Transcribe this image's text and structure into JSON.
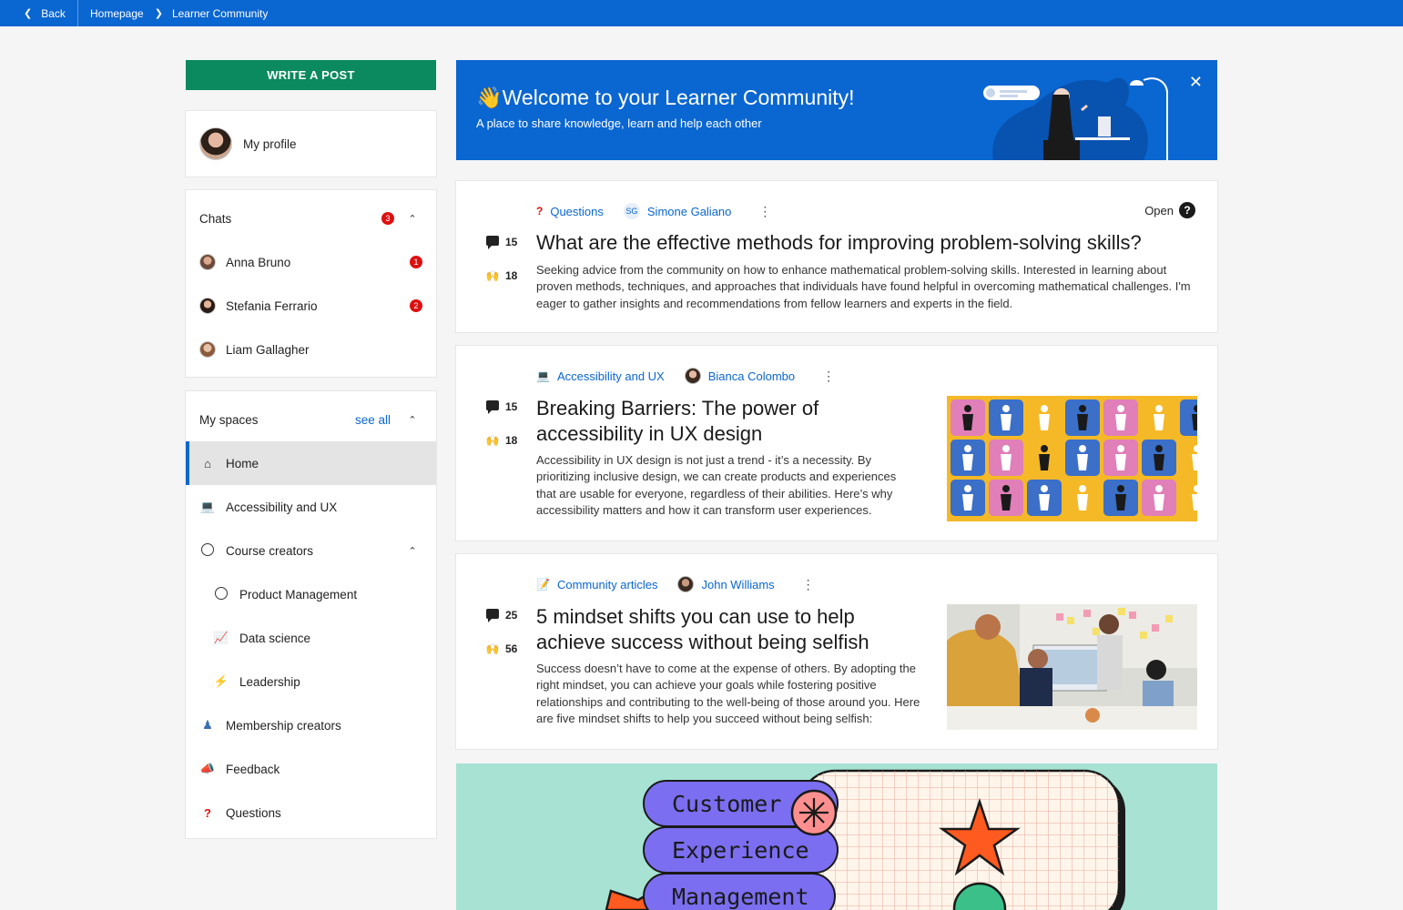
{
  "topbar": {
    "back": "Back",
    "crumbs": [
      "Homepage",
      "Learner Community"
    ]
  },
  "left": {
    "write_post": "WRITE A POST",
    "profile": "My profile",
    "chats": {
      "title": "Chats",
      "count": "3",
      "items": [
        {
          "name": "Anna Bruno",
          "unread": "1"
        },
        {
          "name": "Stefania Ferrario",
          "unread": "2"
        },
        {
          "name": "Liam Gallagher",
          "unread": ""
        }
      ]
    },
    "spaces": {
      "title": "My spaces",
      "see_all": "see all",
      "items": [
        {
          "label": "Home",
          "icon": "home-icon"
        },
        {
          "label": "Accessibility and UX",
          "icon": "laptop-icon"
        },
        {
          "label": "Course creators",
          "icon": "circle-icon"
        },
        {
          "label": "Product Management",
          "icon": "circle-icon"
        },
        {
          "label": "Data science",
          "icon": "chart-icon"
        },
        {
          "label": "Leadership",
          "icon": "lightning-icon"
        },
        {
          "label": "Membership creators",
          "icon": "people-icon"
        },
        {
          "label": "Feedback",
          "icon": "megaphone-icon"
        },
        {
          "label": "Questions",
          "icon": "question-icon"
        }
      ]
    }
  },
  "banner": {
    "emoji": "👋",
    "title": "Welcome to your Learner Community!",
    "subtitle": "A place to share knowledge, learn and help each other"
  },
  "posts": [
    {
      "category": "Questions",
      "author": "Simone Galiano",
      "author_initials": "SG",
      "status": "Open",
      "comments": "15",
      "reactions": "18",
      "title": "What are the effective methods for improving problem-solving skills?",
      "body": "Seeking advice from the community on how to enhance mathematical problem-solving skills. Interested in learning about proven methods, techniques, and approaches that individuals have found helpful in overcoming mathematical challenges. I'm eager to gather insights and recommendations from fellow learners and experts in the field."
    },
    {
      "category": "Accessibility and UX",
      "author": "Bianca Colombo",
      "comments": "15",
      "reactions": "18",
      "title": "Breaking Barriers: The power of accessibility in UX design",
      "body": "Accessibility in UX design is not just a trend - it’s a necessity. By prioritizing inclusive design, we can create products and experiences that are usable for everyone, regardless of their abilities. Here’s why accessibility matters and how it can transform user experiences."
    },
    {
      "category": "Community articles",
      "author": "John Williams",
      "comments": "25",
      "reactions": "56",
      "title": "5 mindset shifts you can use to help achieve success without being selfish",
      "body": "Success doesn’t have to come at the expense of others. By adopting the right mindset, you can achieve your goals while fostering positive relationships and contributing to the well-being of those around you. Here are five mindset shifts to help you succeed without being selfish:"
    }
  ],
  "cx_card": {
    "words": [
      "Customer",
      "Experience",
      "Management"
    ]
  },
  "colors": {
    "primary": "#0a66d0",
    "write_button": "#0a8a5e",
    "badge": "#dd1111",
    "cx_bg": "#a7e2d3",
    "pill": "#7b6ef0"
  }
}
